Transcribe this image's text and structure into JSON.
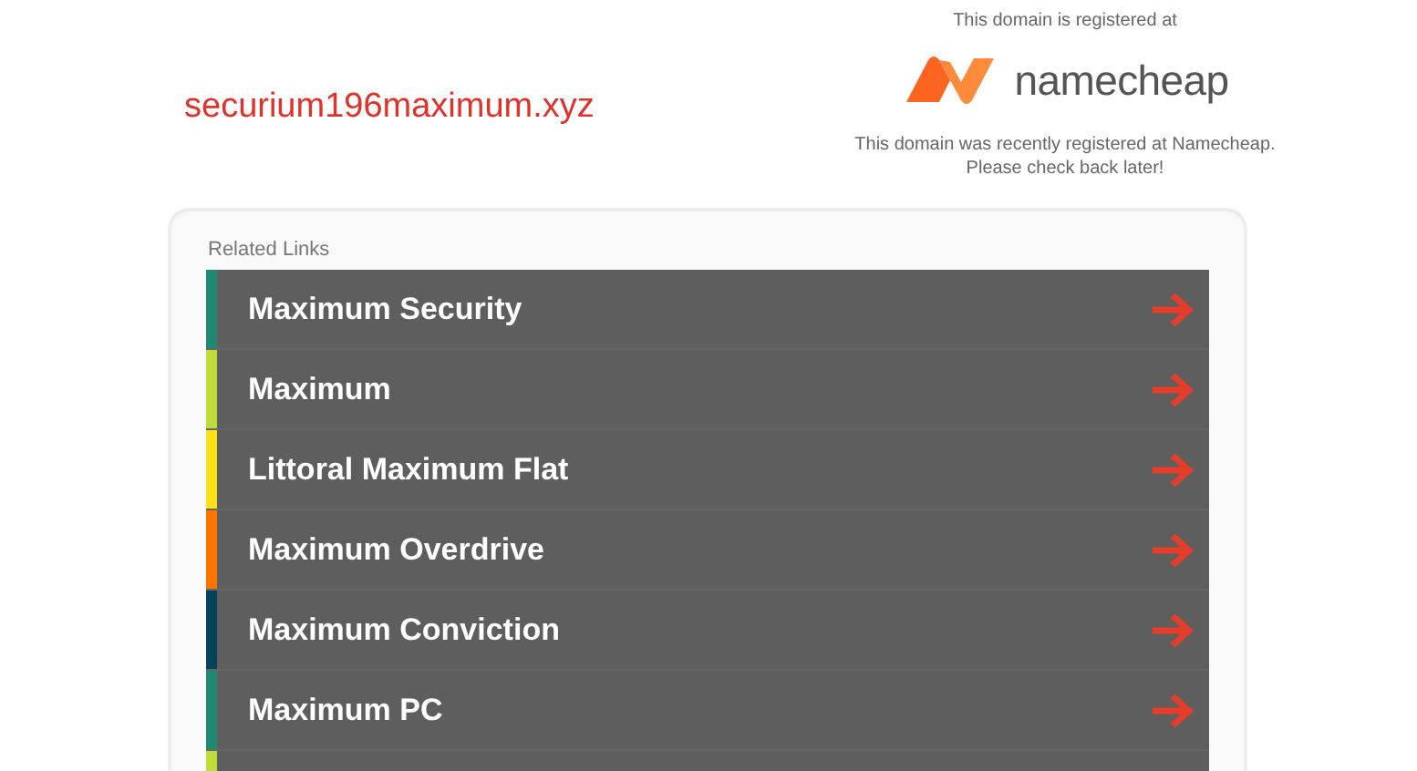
{
  "domain": "securium196maximum.xyz",
  "registrar": {
    "intro": "This domain is registered at",
    "logo_text": "namecheap",
    "message": [
      "This domain was recently registered at Namecheap.",
      "Please check back later!"
    ]
  },
  "related": {
    "title": "Related Links",
    "links": [
      {
        "label": "Maximum Security",
        "color": "#1f8a70"
      },
      {
        "label": "Maximum",
        "color": "#bedb39"
      },
      {
        "label": "Littoral Maximum Flat",
        "color": "#ffe11a"
      },
      {
        "label": "Maximum Overdrive",
        "color": "#fd7400"
      },
      {
        "label": "Maximum Conviction",
        "color": "#004358"
      },
      {
        "label": "Maximum PC",
        "color": "#1f8a70"
      },
      {
        "color": "#bedb39"
      }
    ]
  }
}
